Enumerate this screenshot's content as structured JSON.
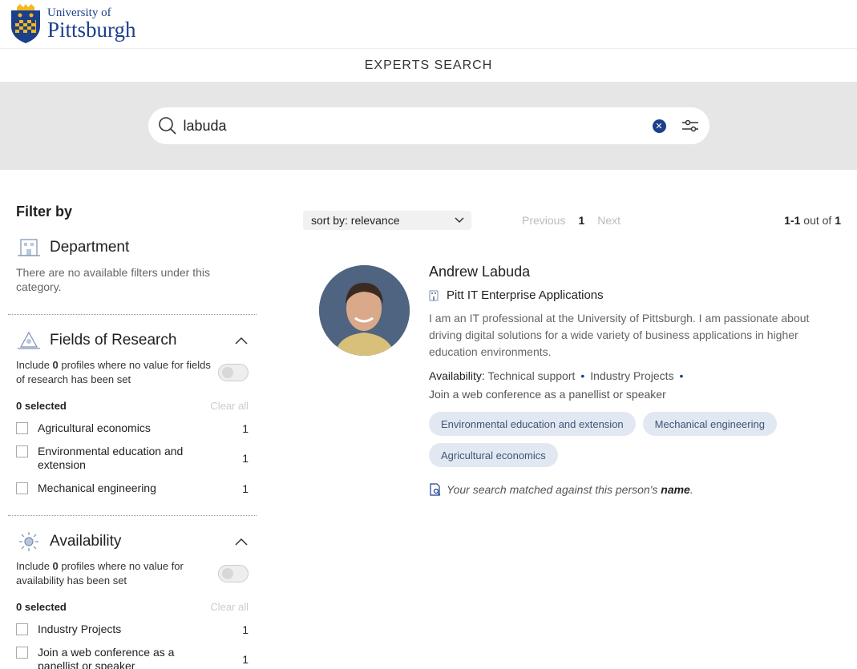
{
  "brand": {
    "line1": "University of",
    "line2": "Pittsburgh"
  },
  "page": {
    "title": "EXPERTS SEARCH"
  },
  "search": {
    "value": "labuda",
    "clear_symbol": "✕"
  },
  "sidebar": {
    "title": "Filter by",
    "department": {
      "title": "Department",
      "note": "There are no available filters under this category."
    },
    "fields": {
      "title": "Fields of Research",
      "include_pre": "Include ",
      "include_count": "0",
      "include_post": " profiles where no value for fields of research has been set",
      "selected": "0 selected",
      "clear_all": "Clear all",
      "options": [
        {
          "label": "Agricultural economics",
          "count": "1"
        },
        {
          "label": "Environmental education and extension",
          "count": "1"
        },
        {
          "label": "Mechanical engineering",
          "count": "1"
        }
      ]
    },
    "availability": {
      "title": "Availability",
      "include_pre": "Include ",
      "include_count": "0",
      "include_post": " profiles where no value for availability has been set",
      "selected": "0 selected",
      "clear_all": "Clear all",
      "options": [
        {
          "label": "Industry Projects",
          "count": "1"
        },
        {
          "label": "Join a web conference as a panellist or speaker",
          "count": "1"
        }
      ]
    }
  },
  "toolbar": {
    "sort_prefix": "sort by: ",
    "sort_value": "relevance",
    "previous": "Previous",
    "page": "1",
    "next": "Next",
    "range": "1-1",
    "range_suffix": " out of ",
    "total": "1"
  },
  "result": {
    "name": "Andrew Labuda",
    "department": "Pitt IT Enterprise Applications",
    "description": "I am an IT professional at the University of Pittsburgh. I am passionate about driving digital solutions for a wide variety of business applications in higher education environments.",
    "availability_label": "Availability:",
    "availability": [
      "Technical support",
      "Industry Projects",
      "Join a web conference as a panellist or speaker"
    ],
    "dot": "•",
    "tags": [
      "Environmental education and extension",
      "Mechanical engineering",
      "Agricultural economics"
    ],
    "match_pre": "Your search matched against this person's ",
    "match_field": "name",
    "match_post": "."
  },
  "colors": {
    "brand": "#1c3f8c",
    "chip_bg": "#e2e8f1",
    "band": "#e6e6e6"
  }
}
